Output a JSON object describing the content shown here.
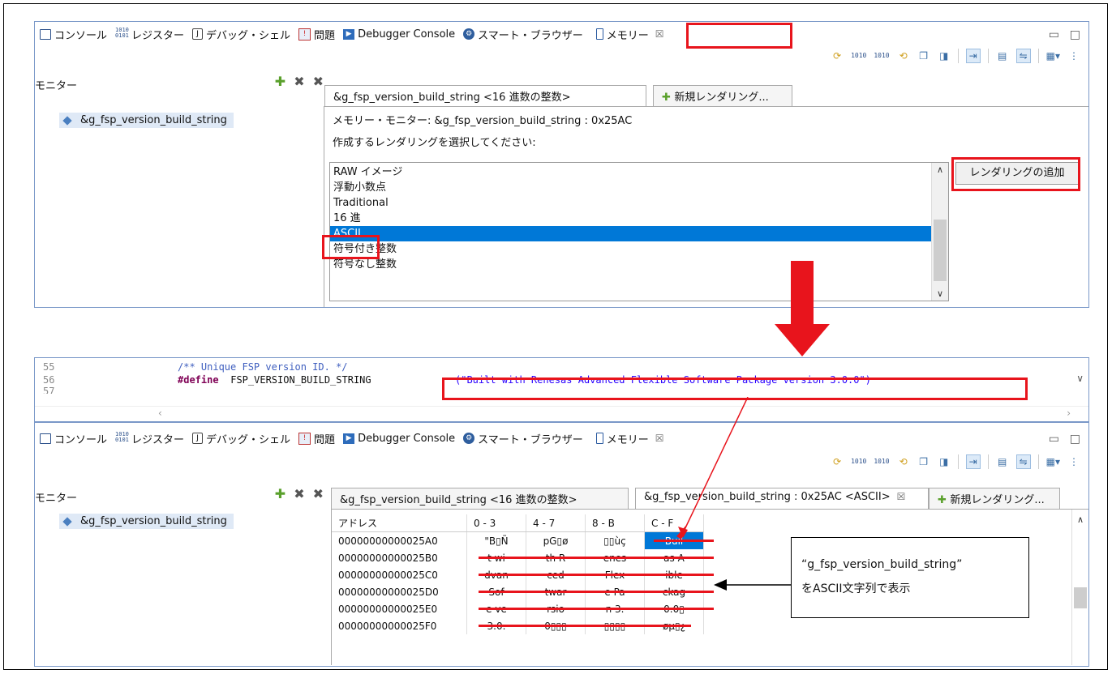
{
  "tabs": {
    "console": "コンソール",
    "register": "レジスター",
    "debug_shell": "デバッグ・シェル",
    "problems": "問題",
    "debugger_console": "Debugger Console",
    "smart_browser": "スマート・ブラウザー",
    "memory": "メモリー"
  },
  "monitor": {
    "title": "モニター",
    "item": "&g_fsp_version_build_string"
  },
  "top": {
    "rendering_tab": "&g_fsp_version_build_string <16 進数の整数>",
    "new_rendering_tab": "新規レンダリング...",
    "memory_monitor_label": "メモリー・モニター: &g_fsp_version_build_string : 0x25AC",
    "select_prompt": "作成するレンダリングを選択してください:",
    "renderings": [
      "RAW イメージ",
      "浮動小数点",
      "Traditional",
      "16 進",
      "ASCII",
      "符号付き整数",
      "符号なし整数"
    ],
    "selected_rendering": "ASCII",
    "add_button": "レンダリングの追加"
  },
  "code": {
    "lines": [
      {
        "num": "55",
        "comment": "/** Unique FSP version ID. */"
      },
      {
        "num": "56",
        "keyword": "#define",
        "name": " FSP_VERSION_BUILD_STRING",
        "value": "(\"Built with Renesas Advanced Flexible Software Package version 3.0.0\")"
      },
      {
        "num": "57"
      }
    ]
  },
  "bottom": {
    "rendering_tab_hex": "&g_fsp_version_build_string <16 進数の整数>",
    "rendering_tab_ascii": "&g_fsp_version_build_string : 0x25AC <ASCII>",
    "new_rendering_tab": "新規レンダリング...",
    "columns": [
      "アドレス",
      "0 - 3",
      "4 - 7",
      "8 - B",
      "C - F"
    ],
    "rows": [
      [
        "00000000000025A0",
        "\"B▯Ñ",
        "pG▯ø",
        "▯▯ùç",
        "Buil"
      ],
      [
        "00000000000025B0",
        "t wi",
        "th R",
        "enes",
        "as A"
      ],
      [
        "00000000000025C0",
        "dvan",
        "ced ",
        "Flex",
        "ible"
      ],
      [
        "00000000000025D0",
        " Sof",
        "twar",
        "e Pa",
        "ckag"
      ],
      [
        "00000000000025E0",
        "e ve",
        "rsio",
        "n 3.",
        "0.0▯"
      ],
      [
        "00000000000025F0",
        "3.0.",
        "0▯▯▯",
        "▯▯▯▯",
        "øµ▯¿"
      ]
    ]
  },
  "annotation": {
    "line1": "“g_fsp_version_build_string”",
    "line2": "をASCII文字列で表示"
  },
  "colors": {
    "highlight": "#e8141c",
    "selection": "#0078d7"
  }
}
